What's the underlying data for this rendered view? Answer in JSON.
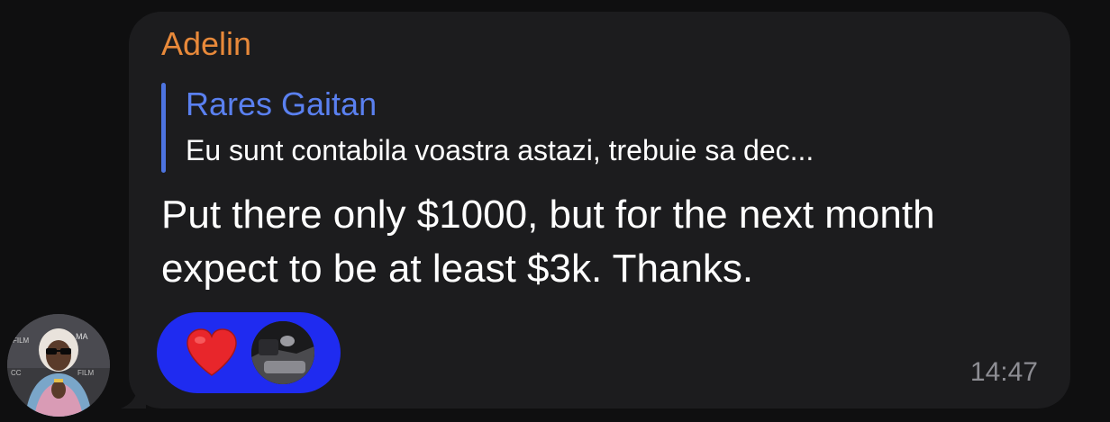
{
  "message": {
    "sender_name": "Adelin",
    "reply": {
      "author": "Rares Gaitan",
      "preview": "Eu sunt contabila voastra astazi, trebuie sa dec..."
    },
    "body": "Put there only $1000, but for the next month expect to be at least $3k. Thanks.",
    "time": "14:47",
    "reactions": [
      {
        "icon": "red-heart-icon",
        "reactor": "reactor-avatar"
      }
    ]
  },
  "avatar_photo_text": {
    "left": "FILM",
    "top_right": "MA",
    "bottom_left": "CC",
    "bottom_right": "FILM"
  },
  "colors": {
    "background": "#0f0f10",
    "bubble": "#1c1c1e",
    "sender": "#e8893a",
    "reply_author": "#5a80f0",
    "reply_bar": "#4d74e0",
    "reaction_pill": "#1f2bf0",
    "time": "#8d8d93"
  }
}
